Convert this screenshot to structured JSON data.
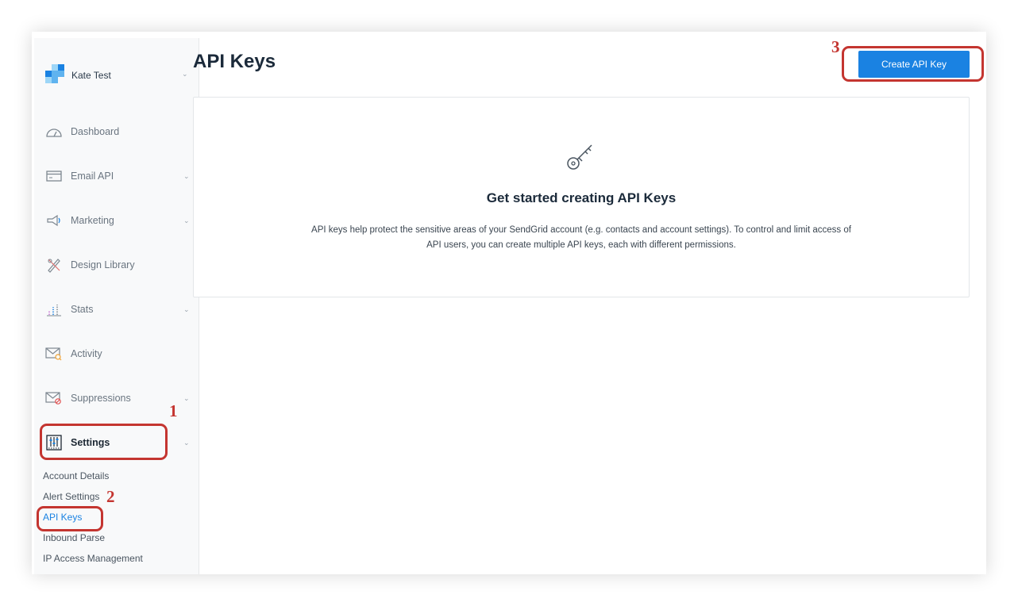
{
  "account": {
    "name": "Kate Test"
  },
  "sidebar": {
    "items": [
      {
        "label": "Dashboard",
        "icon": "dashboard-gauge-icon",
        "has_chevron": false
      },
      {
        "label": "Email API",
        "icon": "email-api-window-icon",
        "has_chevron": true
      },
      {
        "label": "Marketing",
        "icon": "megaphone-icon",
        "has_chevron": true
      },
      {
        "label": "Design Library",
        "icon": "design-tools-icon",
        "has_chevron": false
      },
      {
        "label": "Stats",
        "icon": "bar-chart-icon",
        "has_chevron": true
      },
      {
        "label": "Activity",
        "icon": "envelope-search-icon",
        "has_chevron": false
      },
      {
        "label": "Suppressions",
        "icon": "envelope-block-icon",
        "has_chevron": true
      },
      {
        "label": "Settings",
        "icon": "settings-sliders-icon",
        "has_chevron": true,
        "active": true
      }
    ],
    "settings_sub": [
      {
        "label": "Account Details"
      },
      {
        "label": "Alert Settings"
      },
      {
        "label": "API Keys",
        "active": true
      },
      {
        "label": "Inbound Parse"
      },
      {
        "label": "IP Access Management"
      }
    ]
  },
  "main": {
    "title": "API Keys",
    "create_button": "Create API Key",
    "empty_state": {
      "icon": "key-icon",
      "heading": "Get started creating API Keys",
      "description": "API keys help protect the sensitive areas of your SendGrid account (e.g. contacts and account settings). To control and limit access of API users, you can create multiple API keys, each with different permissions."
    }
  },
  "annotations": [
    "1",
    "2",
    "3"
  ],
  "colors": {
    "accent": "#1a82e2",
    "callout": "#c43530",
    "sidebar_bg": "#f8f9fa",
    "title": "#1b2a3a"
  }
}
